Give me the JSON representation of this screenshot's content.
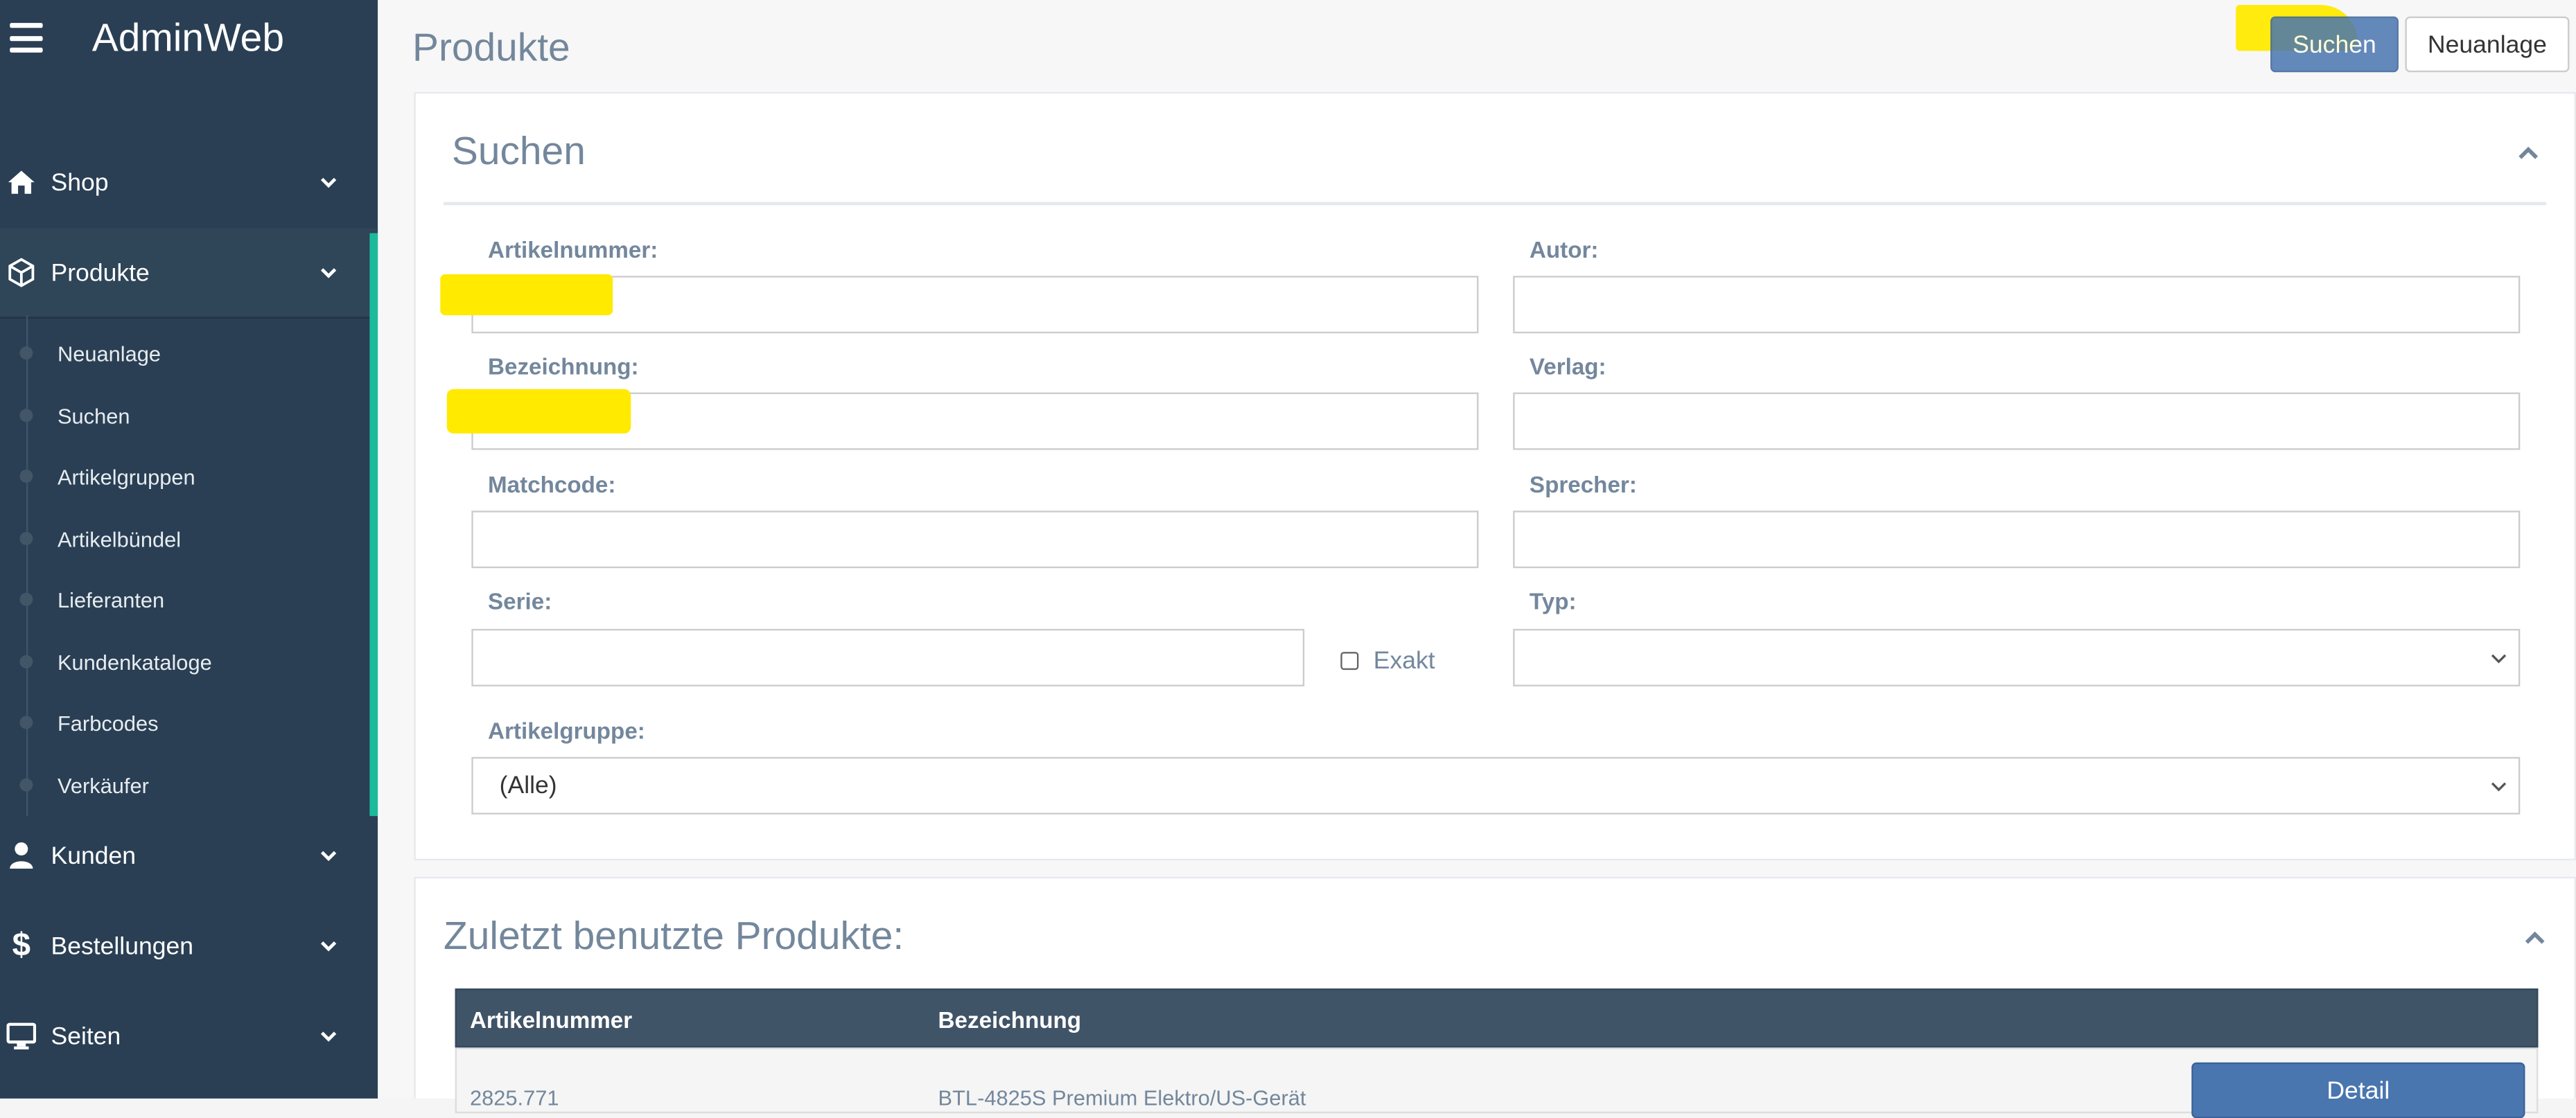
{
  "app": {
    "title": "AdminWeb"
  },
  "sidebar": {
    "items": [
      {
        "label": "Shop",
        "icon": "home-icon"
      },
      {
        "label": "Produkte",
        "icon": "cube-icon"
      },
      {
        "label": "Kunden",
        "icon": "user-icon"
      },
      {
        "label": "Bestellungen",
        "icon": "dollar-icon"
      },
      {
        "label": "Seiten",
        "icon": "desktop-icon"
      }
    ],
    "subitems": [
      "Neuanlage",
      "Suchen",
      "Artikelgruppen",
      "Artikelbündel",
      "Lieferanten",
      "Kundenkataloge",
      "Farbcodes",
      "Verkäufer"
    ]
  },
  "page": {
    "title": "Produkte"
  },
  "toolbar": {
    "search_label": "Suchen",
    "new_label": "Neuanlage"
  },
  "search_panel": {
    "title": "Suchen",
    "fields": {
      "artikelnummer": {
        "label": "Artikelnummer:",
        "value": ""
      },
      "autor": {
        "label": "Autor:",
        "value": ""
      },
      "bezeichnung": {
        "label": "Bezeichnung:",
        "value": ""
      },
      "verlag": {
        "label": "Verlag:",
        "value": ""
      },
      "matchcode": {
        "label": "Matchcode:",
        "value": ""
      },
      "sprecher": {
        "label": "Sprecher:",
        "value": ""
      },
      "serie": {
        "label": "Serie:",
        "value": ""
      },
      "exakt": {
        "label": "Exakt",
        "checked": false
      },
      "typ": {
        "label": "Typ:",
        "value": ""
      },
      "artikelgruppe": {
        "label": "Artikelgruppe:",
        "value": "(Alle)"
      }
    }
  },
  "recent_panel": {
    "title": "Zuletzt benutzte Produkte:",
    "columns": [
      "Artikelnummer",
      "Bezeichnung"
    ],
    "rows": [
      {
        "artikelnummer": "2825.771",
        "bezeichnung": "BTL-4825S Premium Elektro/US-Gerät",
        "action": "Detail"
      }
    ]
  },
  "colors": {
    "sidebar": "#2a3f54",
    "accent_green": "#1abb9c",
    "primary_button": "#4a76b0",
    "highlight": "#ffea00",
    "table_header": "#405467"
  }
}
